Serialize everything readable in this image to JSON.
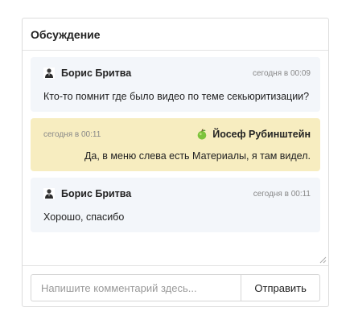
{
  "panel": {
    "title": "Обсуждение"
  },
  "messages": [
    {
      "author": "Борис Бритва",
      "time": "сегодня в 00:09",
      "text": "Кто-то помнит где было видео по теме секьюритизации?",
      "avatar_icon": "person-avatar-icon",
      "side": "left"
    },
    {
      "author": "Йосеф Рубинштейн",
      "time": "сегодня в 00:11",
      "text": "Да, в меню слева есть Материалы, я там видел.",
      "avatar_icon": "green-apple-avatar-icon",
      "side": "right"
    },
    {
      "author": "Борис Бритва",
      "time": "сегодня в 00:11",
      "text": "Хорошо, спасибо",
      "avatar_icon": "person-avatar-icon",
      "side": "left"
    }
  ],
  "composer": {
    "placeholder": "Напишите комментарий здесь...",
    "value": "",
    "send_label": "Отправить"
  },
  "colors": {
    "incoming_bg": "#f3f6fa",
    "outgoing_bg": "#f7edc0",
    "border": "#dcdcdc"
  }
}
